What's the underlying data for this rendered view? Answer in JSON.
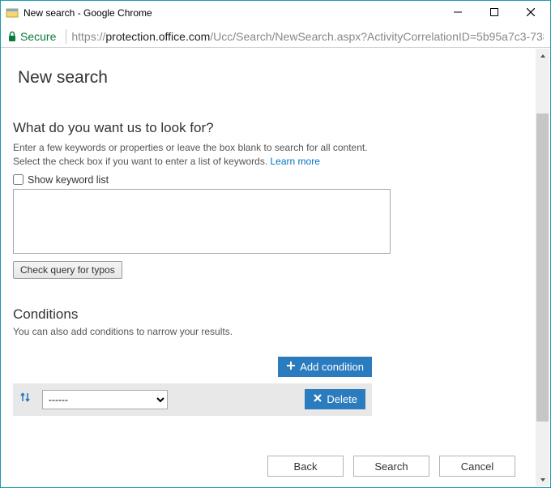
{
  "window": {
    "title": "New search - Google Chrome"
  },
  "addressbar": {
    "secure_label": "Secure",
    "url_prefix": "https://",
    "url_host": "protection.office.com",
    "url_path": "/Ucc/Search/NewSearch.aspx?ActivityCorrelationID=5b95a7c3-738"
  },
  "page": {
    "title": "New search"
  },
  "search_section": {
    "question": "What do you want us to look for?",
    "help_line1": "Enter a few keywords or properties or leave the box blank to search for all content.",
    "help_line2_prefix": "Select the check box if you want to enter a list of keywords. ",
    "learn_more": "Learn more",
    "show_keyword_list_label": "Show keyword list",
    "query_value": "",
    "check_typos_label": "Check query for typos"
  },
  "conditions_section": {
    "title": "Conditions",
    "help": "You can also add conditions to narrow your results.",
    "add_condition_label": "Add condition",
    "delete_label": "Delete",
    "selected_option": "------"
  },
  "footer": {
    "back_label": "Back",
    "search_label": "Search",
    "cancel_label": "Cancel"
  }
}
